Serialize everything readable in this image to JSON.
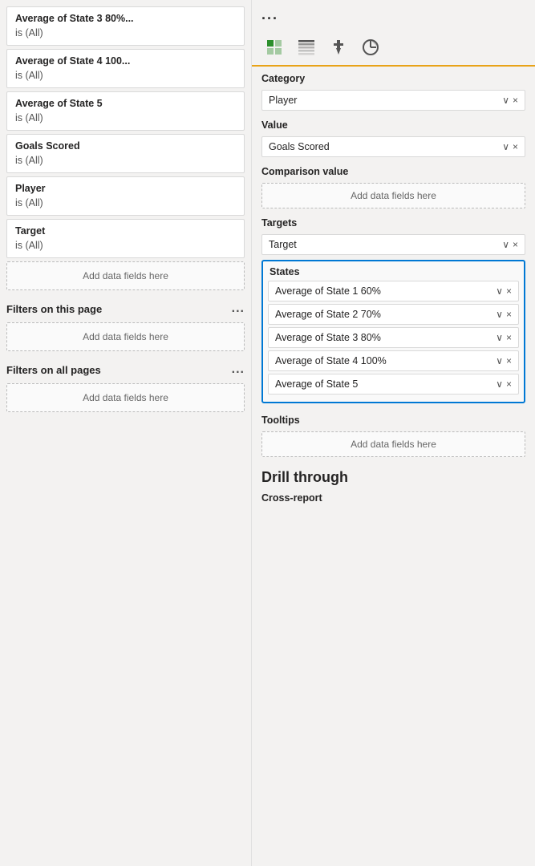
{
  "left_panel": {
    "filters": [
      {
        "name": "Average of State 3 80%...",
        "value": "is (All)"
      },
      {
        "name": "Average of State 4 100...",
        "value": "is (All)"
      },
      {
        "name": "Average of State 5",
        "value": "is (All)"
      },
      {
        "name": "Goals Scored",
        "value": "is (All)"
      },
      {
        "name": "Player",
        "value": "is (All)"
      },
      {
        "name": "Target",
        "value": "is (All)"
      }
    ],
    "add_fields_label": "Add data fields here",
    "filters_on_this_page": "Filters on this page",
    "filters_on_all_pages": "Filters on all pages",
    "ellipsis": "...",
    "add_fields_page_label": "Add data fields here",
    "add_fields_all_label": "Add data fields here"
  },
  "right_panel": {
    "ellipsis": "...",
    "icons": [
      "grid-icon",
      "paint-icon",
      "filter-icon"
    ],
    "category_label": "Category",
    "category_field": "Player",
    "value_label": "Value",
    "value_field": "Goals Scored",
    "comparison_label": "Comparison value",
    "comparison_placeholder": "Add data fields here",
    "targets_label": "Targets",
    "targets_field": "Target",
    "states_label": "States",
    "states_fields": [
      "Average of State 1 60%",
      "Average of State 2 70%",
      "Average of State 3 80%",
      "Average of State 4 100%",
      "Average of State 5"
    ],
    "tooltips_label": "Tooltips",
    "tooltips_placeholder": "Add data fields here",
    "drill_through_label": "Drill through",
    "cross_report_label": "Cross-report"
  }
}
